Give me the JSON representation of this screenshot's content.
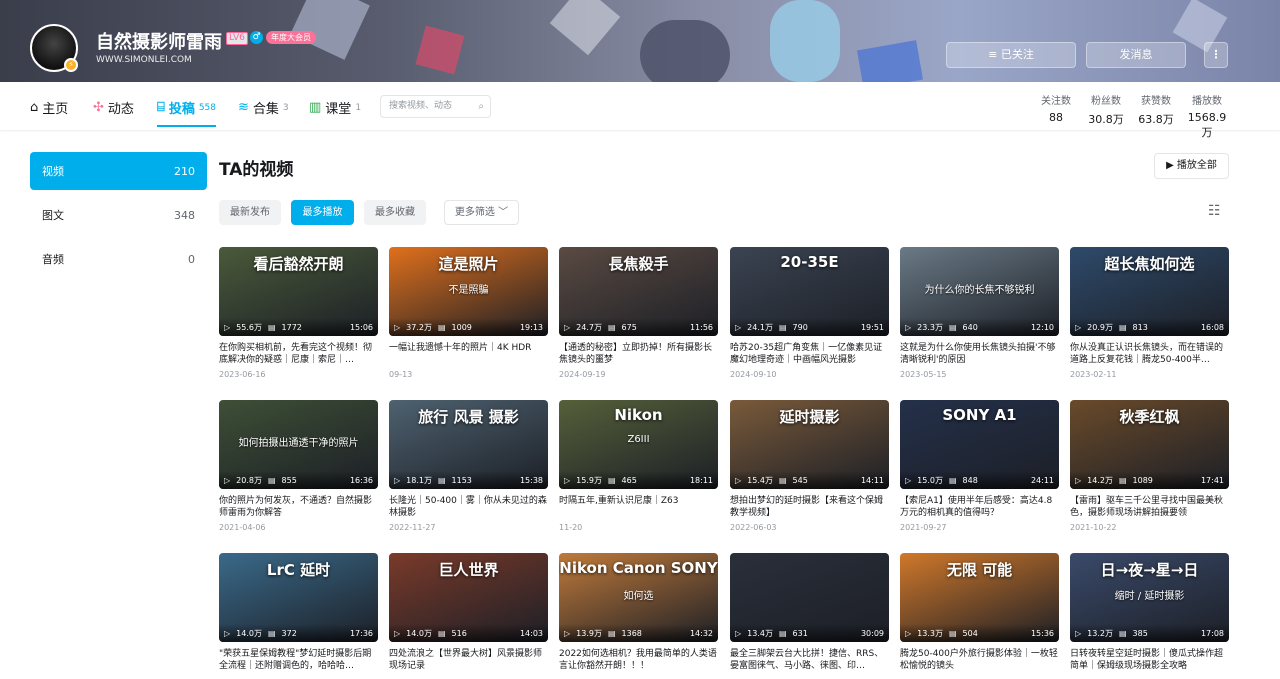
{
  "header": {
    "username": "自然摄影师雷雨",
    "level": "LV6",
    "gender_icon": "♂",
    "vip_badge": "年度大会员",
    "website": "WWW.SIMONLEI.COM",
    "follow_button": "≡ 已关注",
    "message_button": "发消息",
    "more_button": "⋮"
  },
  "nav": {
    "home": "主页",
    "dynamic": "动态",
    "posts": "投稿",
    "posts_count": "558",
    "collections": "合集",
    "collections_count": "3",
    "classroom": "课堂",
    "classroom_count": "1",
    "search_placeholder": "搜索视频、动态"
  },
  "stats": [
    {
      "label": "关注数",
      "value": "88"
    },
    {
      "label": "粉丝数",
      "value": "30.8万"
    },
    {
      "label": "获赞数",
      "value": "63.8万"
    },
    {
      "label": "播放数",
      "value": "1568.9万"
    }
  ],
  "sidebar": [
    {
      "label": "视频",
      "count": "210"
    },
    {
      "label": "图文",
      "count": "348"
    },
    {
      "label": "音频",
      "count": "0"
    }
  ],
  "main": {
    "title": "TA的视频",
    "play_all": "▶ 播放全部",
    "filters": [
      "最新发布",
      "最多播放",
      "最多收藏"
    ],
    "more_filters": "更多筛选 ﹀",
    "selected_filter": "最多播放"
  },
  "videos": [
    {
      "thumb_text": "看后豁然开朗",
      "thumb_sub": "",
      "views": "55.6万",
      "danmaku": "1772",
      "duration": "15:06",
      "title": "在你购买相机前，先看完这个视频！彻底解决你的疑惑｜尼康｜索尼｜…",
      "date": "2023-06-16",
      "bg": "#4a5a3a"
    },
    {
      "thumb_text": "這是照片",
      "thumb_sub": "不是照騙",
      "views": "37.2万",
      "danmaku": "1009",
      "duration": "19:13",
      "title": "一幅让我遗憾十年的照片｜4K HDR",
      "date": "09-13",
      "bg": "#e0701c"
    },
    {
      "thumb_text": "長焦殺手",
      "thumb_sub": "",
      "views": "24.7万",
      "danmaku": "675",
      "duration": "11:56",
      "title": "【通透的秘密】立即扔掉！所有摄影长焦镜头的噩梦",
      "date": "2024-09-19",
      "bg": "#5a4a42"
    },
    {
      "thumb_text": "20-35E",
      "thumb_sub": "",
      "views": "24.1万",
      "danmaku": "790",
      "duration": "19:51",
      "title": "哈苏20-35超广角变焦｜一亿像素见证魔幻地理奇迹｜中画幅风光摄影",
      "date": "2024-09-10",
      "bg": "#3b4452"
    },
    {
      "thumb_text": "",
      "thumb_sub": "为什么你的长焦不够锐利",
      "views": "23.3万",
      "danmaku": "640",
      "duration": "12:10",
      "title": "这就是为什么你使用长焦镜头拍摄'不够清晰锐利'的原因",
      "date": "2023-05-15",
      "bg": "#6a7a86"
    },
    {
      "thumb_text": "超长焦如何选",
      "thumb_sub": "",
      "views": "20.9万",
      "danmaku": "813",
      "duration": "16:08",
      "title": "你从没真正认识长焦镜头，而在错误的道路上反复花钱｜腾龙50-400半…",
      "date": "2023-02-11",
      "bg": "#2e4a6a"
    },
    {
      "thumb_text": "",
      "thumb_sub": "如何拍摄出通透干净的照片",
      "views": "20.8万",
      "danmaku": "855",
      "duration": "16:36",
      "title": "你的照片为何发灰，不通透？自然摄影师雷雨为你解答",
      "date": "2021-04-06",
      "bg": "#3e4f36"
    },
    {
      "thumb_text": "旅行 风景 摄影",
      "thumb_sub": "",
      "views": "18.1万",
      "danmaku": "1153",
      "duration": "15:38",
      "title": "长隆光｜50-400｜雾｜你从未见过的森林摄影",
      "date": "2022-11-27",
      "bg": "#4e6270"
    },
    {
      "thumb_text": "Nikon",
      "thumb_sub": "Z6III",
      "views": "15.9万",
      "danmaku": "465",
      "duration": "18:11",
      "title": "时隔五年,重新认识尼康｜Z63",
      "date": "11-20",
      "bg": "#55603a"
    },
    {
      "thumb_text": "延时摄影",
      "thumb_sub": "",
      "views": "15.4万",
      "danmaku": "545",
      "duration": "14:11",
      "title": "想拍出梦幻的延时摄影【来看这个保姆教学视频】",
      "date": "2022-06-03",
      "bg": "#7a5a3a"
    },
    {
      "thumb_text": "SONY A1",
      "thumb_sub": "",
      "views": "15.0万",
      "danmaku": "848",
      "duration": "24:11",
      "title": "【索尼A1】使用半年后感受：高达4.8万元的相机真的值得吗？",
      "date": "2021-09-27",
      "bg": "#24304a"
    },
    {
      "thumb_text": "秋季红枫",
      "thumb_sub": "",
      "views": "14.2万",
      "danmaku": "1089",
      "duration": "17:41",
      "title": "【雷雨】驱车三千公里寻找中国最美秋色，摄影师现场讲解拍摄要领",
      "date": "2021-10-22",
      "bg": "#6a4a2a"
    },
    {
      "thumb_text": "LrC 延时",
      "thumb_sub": "",
      "views": "14.0万",
      "danmaku": "372",
      "duration": "17:36",
      "title": "\"荣获五星保姆教程\"梦幻延时摄影后期全流程｜还附赠调色的，哈哈哈…",
      "date": "",
      "bg": "#3a6a8a"
    },
    {
      "thumb_text": "巨人世界",
      "thumb_sub": "",
      "views": "14.0万",
      "danmaku": "516",
      "duration": "14:03",
      "title": "四处流浪之【世界最大树】风景摄影师现场记录",
      "date": "",
      "bg": "#7a3a2a"
    },
    {
      "thumb_text": "Nikon Canon SONY",
      "thumb_sub": "如何选",
      "views": "13.9万",
      "danmaku": "1368",
      "duration": "14:32",
      "title": "2022如何选相机？我用最简单的人类语言让你豁然开朗！！！",
      "date": "",
      "bg": "#c07a3a"
    },
    {
      "thumb_text": "",
      "thumb_sub": "",
      "views": "13.4万",
      "danmaku": "631",
      "duration": "30:09",
      "title": "最全三脚架云台大比拼！捷信、RRS、晏富图徕气、马小路、徕图、印…",
      "date": "",
      "bg": "#2a2f3a"
    },
    {
      "thumb_text": "无限 可能",
      "thumb_sub": "",
      "views": "13.3万",
      "danmaku": "504",
      "duration": "15:36",
      "title": "腾龙50-400户外旅行摄影体验｜一枚轻松愉悦的镜头",
      "date": "",
      "bg": "#d0782a"
    },
    {
      "thumb_text": "日→夜→星→日",
      "thumb_sub": "缩时 / 延时摄影",
      "views": "13.2万",
      "danmaku": "385",
      "duration": "17:08",
      "title": "日转夜转星空延时摄影｜傻瓜式操作超简单｜保姆级现场摄影全攻略",
      "date": "",
      "bg": "#3a4a6a"
    }
  ],
  "colors": {
    "accent": "#00aeec",
    "pink": "#fb7299"
  }
}
